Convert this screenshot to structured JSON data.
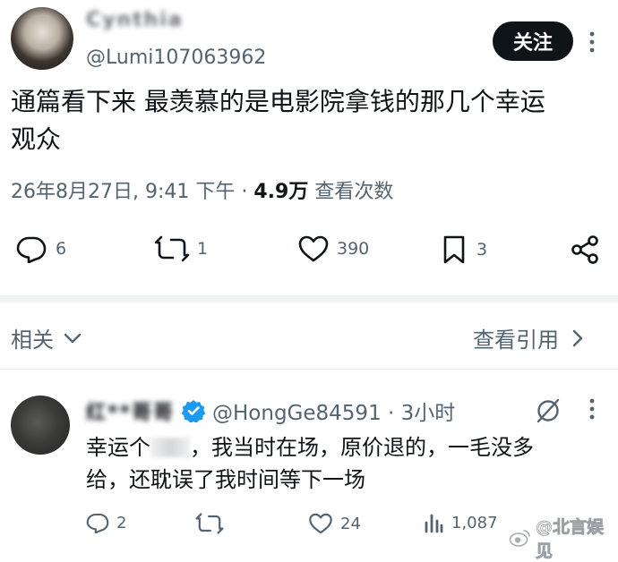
{
  "post": {
    "display_name": "Cynthia",
    "handle": "@Lumi107063962",
    "follow_label": "关注",
    "text_line1": "通篇看下来 最羡慕的是电影院拿钱的那几个幸运",
    "text_line2": "观众",
    "timestamp": "26年8月27日, 9:41 下午 ·",
    "views_count": "4.9万",
    "views_label": "查看次数",
    "actions": {
      "replies": "6",
      "reposts": "1",
      "likes": "390",
      "bookmarks": "3"
    }
  },
  "related": {
    "label": "相关",
    "view_quotes": "查看引用"
  },
  "reply": {
    "display_name": "红**哥哥",
    "handle_time": "@HongGe84591 · 3小时",
    "text_line1_a": "幸运个",
    "text_line1_b": "，我当时在场，原价退的，一毛没多",
    "text_line2": "给，还耽误了我时间等下一场",
    "actions": {
      "replies": "2",
      "likes": "24",
      "views": "1,087"
    }
  },
  "watermark": "@北言娱见",
  "colors": {
    "accent_blue": "#1d9bf0",
    "text": "#0f1419",
    "muted": "#536471"
  }
}
